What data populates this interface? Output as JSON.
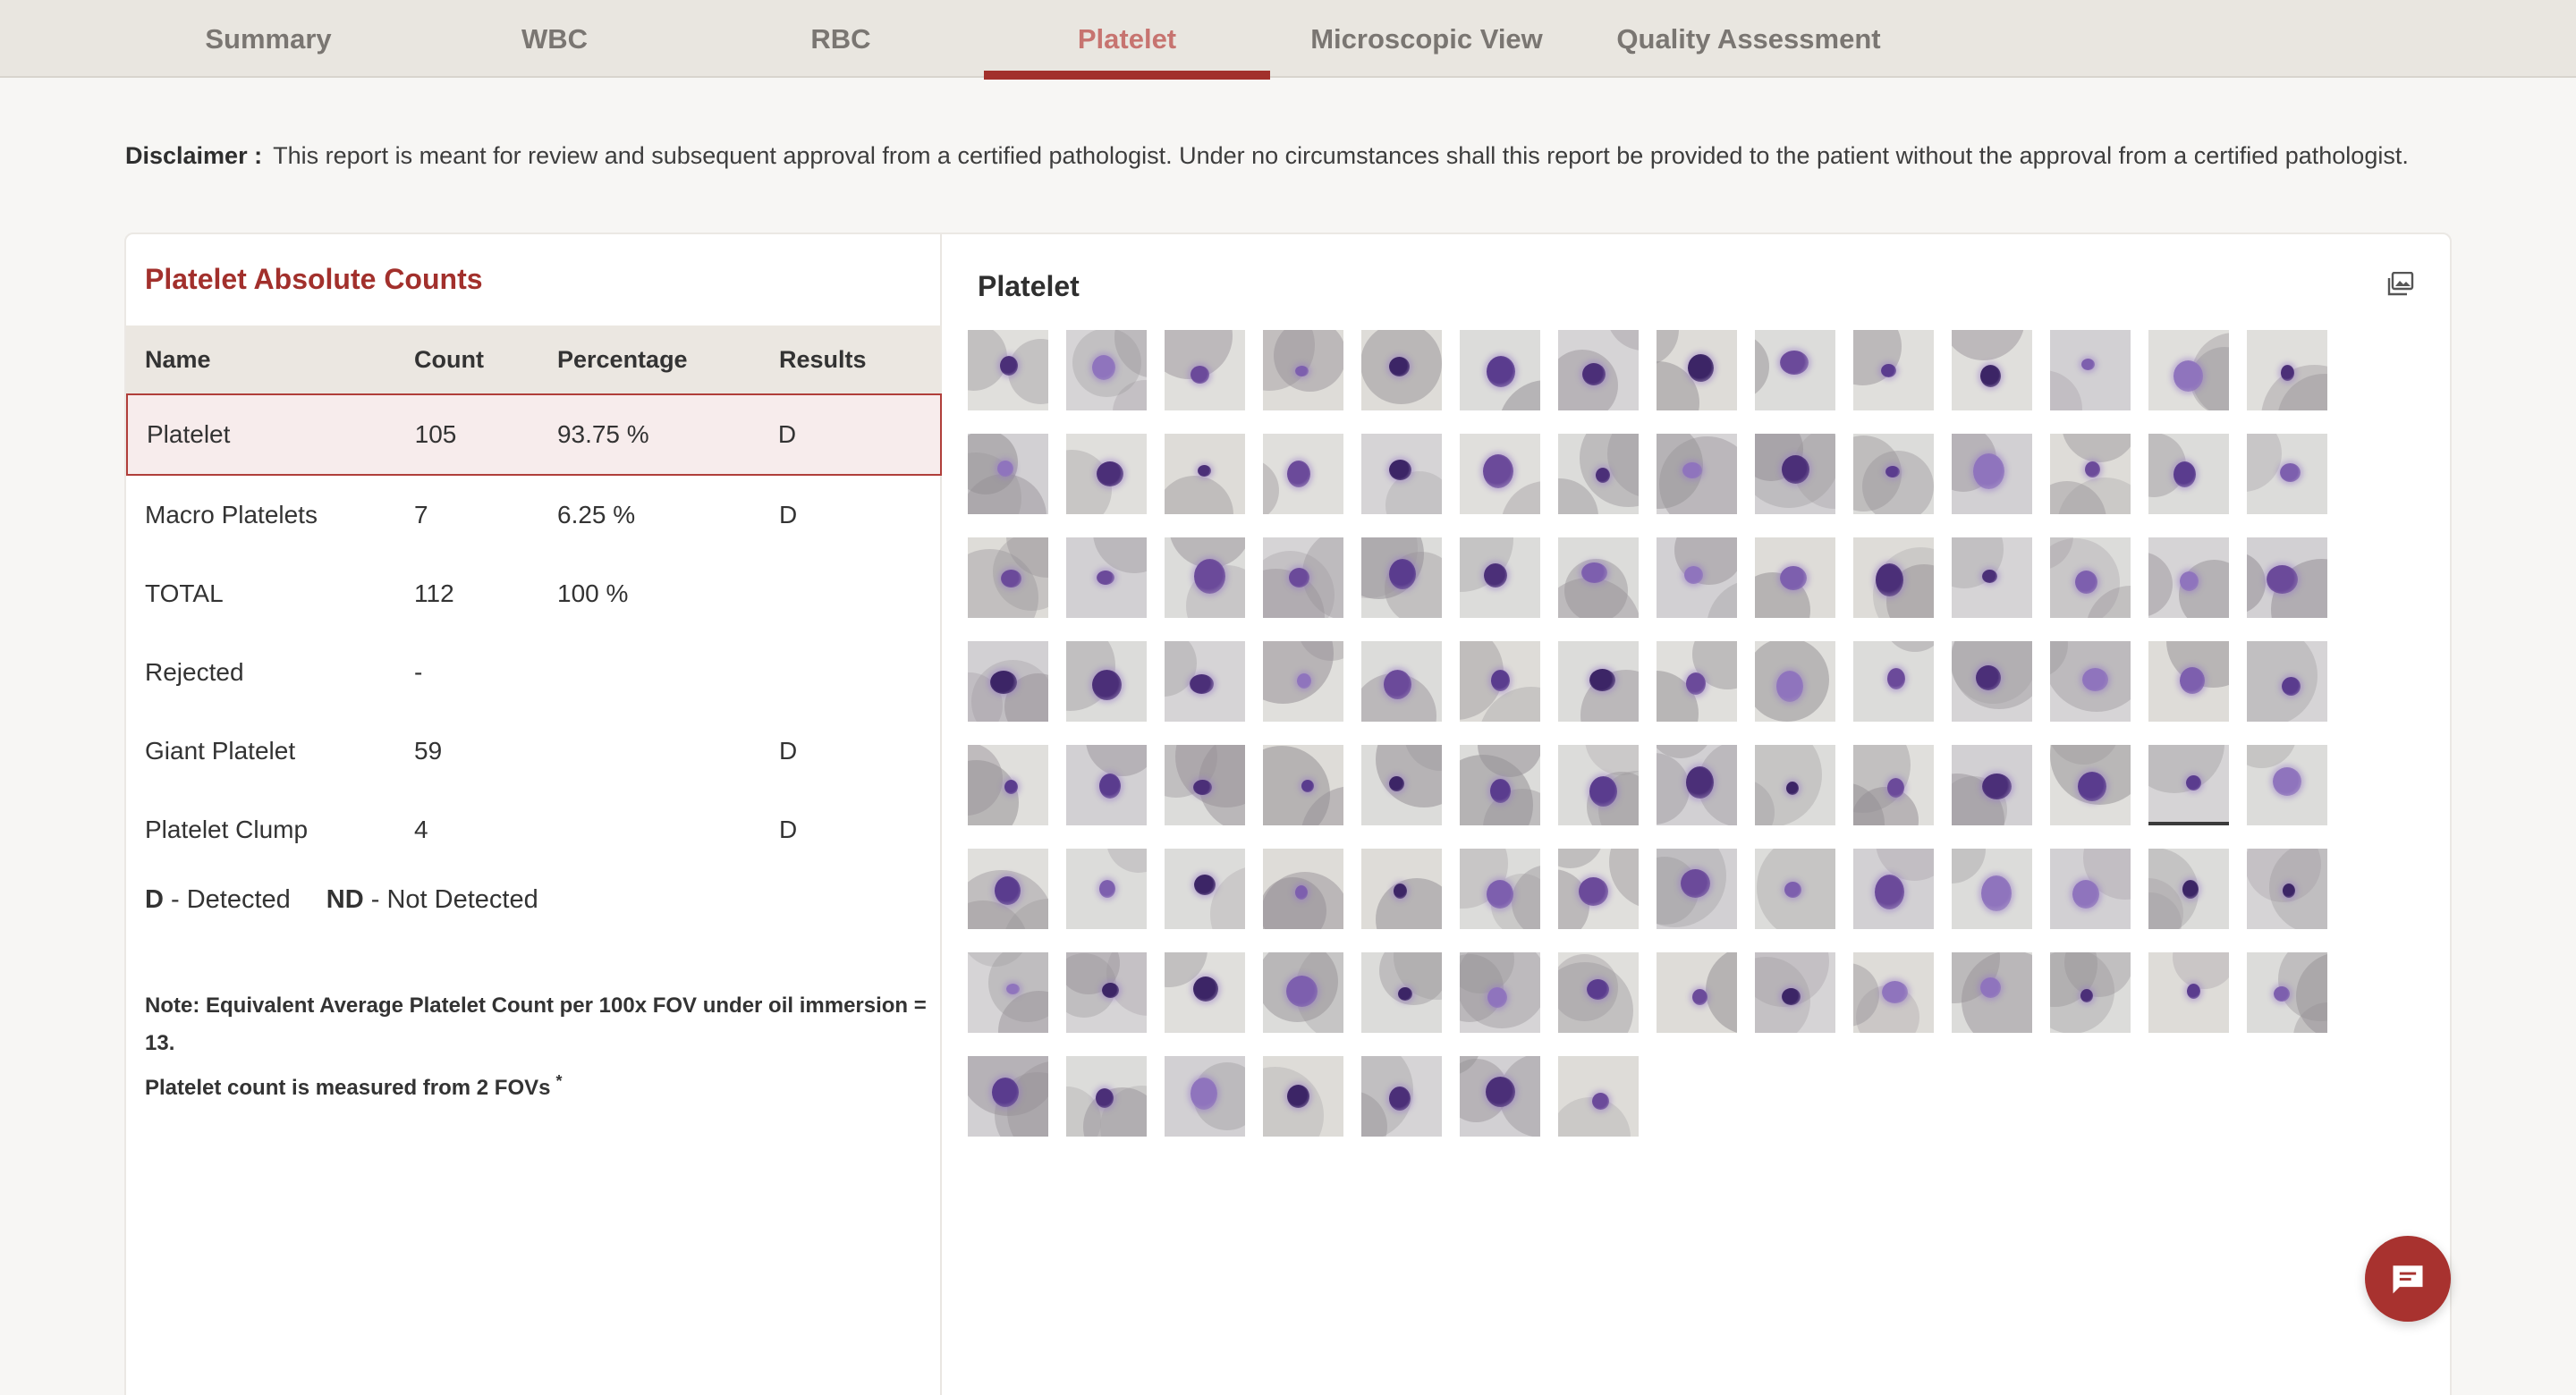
{
  "tabs": [
    {
      "label": "Summary",
      "active": false
    },
    {
      "label": "WBC",
      "active": false
    },
    {
      "label": "RBC",
      "active": false
    },
    {
      "label": "Platelet",
      "active": true
    },
    {
      "label": "Microscopic View",
      "active": false
    },
    {
      "label": "Quality Assessment",
      "active": false
    }
  ],
  "disclaimer": {
    "label": "Disclaimer :",
    "text": "This report is meant for review and subsequent approval from a certified pathologist. Under no circumstances shall this report be provided to the patient without the approval from a certified pathologist."
  },
  "counts": {
    "title": "Platelet Absolute Counts",
    "headers": {
      "name": "Name",
      "count": "Count",
      "percentage": "Percentage",
      "results": "Results"
    },
    "rows": [
      {
        "name": "Platelet",
        "count": "105",
        "percentage": "93.75 %",
        "result": "D",
        "selected": true
      },
      {
        "name": "Macro Platelets",
        "count": "7",
        "percentage": "6.25 %",
        "result": "D"
      },
      {
        "name": "TOTAL",
        "count": "112",
        "percentage": "100 %",
        "result": ""
      },
      {
        "name": "Rejected",
        "count": "-",
        "percentage": "",
        "result": ""
      },
      {
        "name": "Giant Platelet",
        "count": "59",
        "percentage": "",
        "result": "D"
      },
      {
        "name": "Platelet Clump",
        "count": "4",
        "percentage": "",
        "result": "D"
      }
    ],
    "legend": [
      {
        "code": "D",
        "meaning": " - Detected"
      },
      {
        "code": "ND",
        "meaning": " - Not Detected"
      }
    ],
    "note_line1": "Note: Equivalent Average Platelet Count per 100x FOV under oil immersion = 13.",
    "note_line2": "Platelet count is measured from 2 FOVs",
    "note_mark": "*"
  },
  "gallery": {
    "title": "Platelet",
    "icon": "image-gallery-icon",
    "thumbnail_count": 105,
    "selected_index": 68
  },
  "chat": {
    "icon": "chat-icon"
  },
  "colors": {
    "accent": "#a2302c",
    "active_tab_text": "#c77470",
    "selected_row_bg": "#f7ecec",
    "tabbar_bg": "#e9e6e0",
    "stain_purple": "#5c3d8f"
  }
}
